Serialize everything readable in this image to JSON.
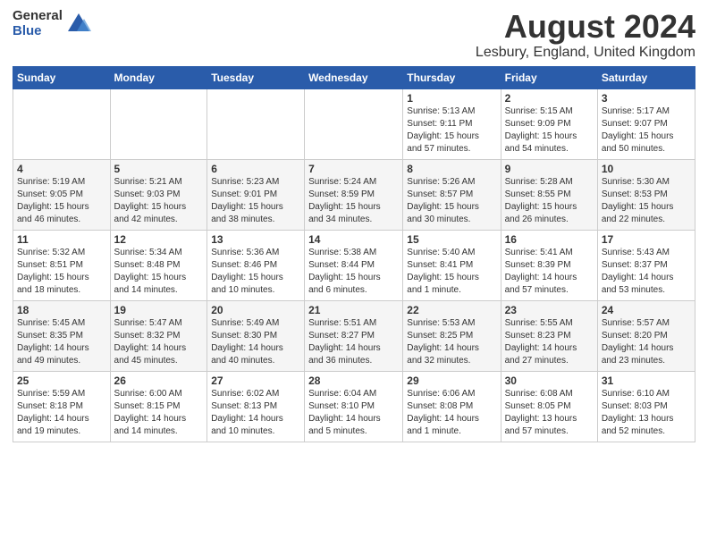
{
  "header": {
    "logo_general": "General",
    "logo_blue": "Blue",
    "month": "August 2024",
    "location": "Lesbury, England, United Kingdom"
  },
  "weekdays": [
    "Sunday",
    "Monday",
    "Tuesday",
    "Wednesday",
    "Thursday",
    "Friday",
    "Saturday"
  ],
  "weeks": [
    [
      {
        "day": "",
        "info": ""
      },
      {
        "day": "",
        "info": ""
      },
      {
        "day": "",
        "info": ""
      },
      {
        "day": "",
        "info": ""
      },
      {
        "day": "1",
        "info": "Sunrise: 5:13 AM\nSunset: 9:11 PM\nDaylight: 15 hours\nand 57 minutes."
      },
      {
        "day": "2",
        "info": "Sunrise: 5:15 AM\nSunset: 9:09 PM\nDaylight: 15 hours\nand 54 minutes."
      },
      {
        "day": "3",
        "info": "Sunrise: 5:17 AM\nSunset: 9:07 PM\nDaylight: 15 hours\nand 50 minutes."
      }
    ],
    [
      {
        "day": "4",
        "info": "Sunrise: 5:19 AM\nSunset: 9:05 PM\nDaylight: 15 hours\nand 46 minutes."
      },
      {
        "day": "5",
        "info": "Sunrise: 5:21 AM\nSunset: 9:03 PM\nDaylight: 15 hours\nand 42 minutes."
      },
      {
        "day": "6",
        "info": "Sunrise: 5:23 AM\nSunset: 9:01 PM\nDaylight: 15 hours\nand 38 minutes."
      },
      {
        "day": "7",
        "info": "Sunrise: 5:24 AM\nSunset: 8:59 PM\nDaylight: 15 hours\nand 34 minutes."
      },
      {
        "day": "8",
        "info": "Sunrise: 5:26 AM\nSunset: 8:57 PM\nDaylight: 15 hours\nand 30 minutes."
      },
      {
        "day": "9",
        "info": "Sunrise: 5:28 AM\nSunset: 8:55 PM\nDaylight: 15 hours\nand 26 minutes."
      },
      {
        "day": "10",
        "info": "Sunrise: 5:30 AM\nSunset: 8:53 PM\nDaylight: 15 hours\nand 22 minutes."
      }
    ],
    [
      {
        "day": "11",
        "info": "Sunrise: 5:32 AM\nSunset: 8:51 PM\nDaylight: 15 hours\nand 18 minutes."
      },
      {
        "day": "12",
        "info": "Sunrise: 5:34 AM\nSunset: 8:48 PM\nDaylight: 15 hours\nand 14 minutes."
      },
      {
        "day": "13",
        "info": "Sunrise: 5:36 AM\nSunset: 8:46 PM\nDaylight: 15 hours\nand 10 minutes."
      },
      {
        "day": "14",
        "info": "Sunrise: 5:38 AM\nSunset: 8:44 PM\nDaylight: 15 hours\nand 6 minutes."
      },
      {
        "day": "15",
        "info": "Sunrise: 5:40 AM\nSunset: 8:41 PM\nDaylight: 15 hours\nand 1 minute."
      },
      {
        "day": "16",
        "info": "Sunrise: 5:41 AM\nSunset: 8:39 PM\nDaylight: 14 hours\nand 57 minutes."
      },
      {
        "day": "17",
        "info": "Sunrise: 5:43 AM\nSunset: 8:37 PM\nDaylight: 14 hours\nand 53 minutes."
      }
    ],
    [
      {
        "day": "18",
        "info": "Sunrise: 5:45 AM\nSunset: 8:35 PM\nDaylight: 14 hours\nand 49 minutes."
      },
      {
        "day": "19",
        "info": "Sunrise: 5:47 AM\nSunset: 8:32 PM\nDaylight: 14 hours\nand 45 minutes."
      },
      {
        "day": "20",
        "info": "Sunrise: 5:49 AM\nSunset: 8:30 PM\nDaylight: 14 hours\nand 40 minutes."
      },
      {
        "day": "21",
        "info": "Sunrise: 5:51 AM\nSunset: 8:27 PM\nDaylight: 14 hours\nand 36 minutes."
      },
      {
        "day": "22",
        "info": "Sunrise: 5:53 AM\nSunset: 8:25 PM\nDaylight: 14 hours\nand 32 minutes."
      },
      {
        "day": "23",
        "info": "Sunrise: 5:55 AM\nSunset: 8:23 PM\nDaylight: 14 hours\nand 27 minutes."
      },
      {
        "day": "24",
        "info": "Sunrise: 5:57 AM\nSunset: 8:20 PM\nDaylight: 14 hours\nand 23 minutes."
      }
    ],
    [
      {
        "day": "25",
        "info": "Sunrise: 5:59 AM\nSunset: 8:18 PM\nDaylight: 14 hours\nand 19 minutes."
      },
      {
        "day": "26",
        "info": "Sunrise: 6:00 AM\nSunset: 8:15 PM\nDaylight: 14 hours\nand 14 minutes."
      },
      {
        "day": "27",
        "info": "Sunrise: 6:02 AM\nSunset: 8:13 PM\nDaylight: 14 hours\nand 10 minutes."
      },
      {
        "day": "28",
        "info": "Sunrise: 6:04 AM\nSunset: 8:10 PM\nDaylight: 14 hours\nand 5 minutes."
      },
      {
        "day": "29",
        "info": "Sunrise: 6:06 AM\nSunset: 8:08 PM\nDaylight: 14 hours\nand 1 minute."
      },
      {
        "day": "30",
        "info": "Sunrise: 6:08 AM\nSunset: 8:05 PM\nDaylight: 13 hours\nand 57 minutes."
      },
      {
        "day": "31",
        "info": "Sunrise: 6:10 AM\nSunset: 8:03 PM\nDaylight: 13 hours\nand 52 minutes."
      }
    ]
  ]
}
